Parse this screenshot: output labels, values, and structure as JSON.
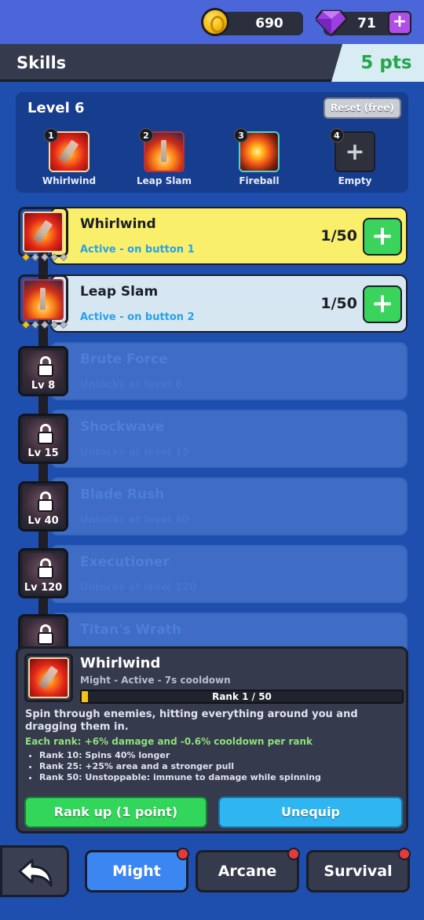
{
  "currency": {
    "coins": "690",
    "gems": "71",
    "add_label": "+"
  },
  "header": {
    "title": "Skills",
    "points": "5 pts"
  },
  "loadout": {
    "level": "Level 6",
    "reset_label": "Reset (free)",
    "slots": [
      {
        "num": "1",
        "label": "Whirlwind",
        "icon": "whirlwind-icon"
      },
      {
        "num": "2",
        "label": "Leap Slam",
        "icon": "leap-slam-icon"
      },
      {
        "num": "3",
        "label": "Fireball",
        "icon": "fireball-icon"
      },
      {
        "num": "4",
        "label": "Empty",
        "icon": "plus-icon"
      }
    ]
  },
  "skills": [
    {
      "name": "Whirlwind",
      "status": "Active  -  on button 1",
      "rank": "1/50",
      "rank_fraction": 0.02,
      "state": "unlocked"
    },
    {
      "name": "Leap Slam",
      "status": "Active  -  on button 2",
      "rank": "1/50",
      "rank_fraction": 0.02,
      "state": "unlocked"
    },
    {
      "name": "Brute Force",
      "status": "Unlocks at level 8",
      "lock_level": "Lv 8",
      "state": "locked"
    },
    {
      "name": "Shockwave",
      "status": "Unlocks at level 15",
      "lock_level": "Lv 15",
      "state": "locked"
    },
    {
      "name": "Blade Rush",
      "status": "Unlocks at level 40",
      "lock_level": "Lv 40",
      "state": "locked"
    },
    {
      "name": "Executioner",
      "status": "Unlocks at level 120",
      "lock_level": "Lv 120",
      "state": "locked"
    },
    {
      "name": "Titan's Wrath",
      "status": "",
      "state": "locked"
    }
  ],
  "detail": {
    "name": "Whirlwind",
    "meta": "Might  -  Active  -  7s cooldown",
    "rank_text": "Rank 1 / 50",
    "rank_fraction": 0.02,
    "description": "Spin through enemies, hitting everything around you and dragging them in.",
    "each_rank": "Each rank: +6% damage and -0.6% cooldown per rank",
    "milestones": [
      "Rank 10: Spins 40% longer",
      "Rank 25: +25% area and a stronger pull",
      "Rank 50: Unstoppable: immune to damage while spinning"
    ],
    "rank_up_label": "Rank up  (1 point)",
    "unequip_label": "Unequip"
  },
  "tabs": [
    {
      "label": "Might",
      "active": true
    },
    {
      "label": "Arcane",
      "active": false
    },
    {
      "label": "Survival",
      "active": false
    }
  ],
  "colors": {
    "background": "#1f4fae",
    "highlight_card": "#f9ef6a",
    "points_green": "#26a64a",
    "rank_up_green": "#31d65b",
    "unequip_blue": "#2fb6f0",
    "active_tab": "#3c86f2"
  }
}
